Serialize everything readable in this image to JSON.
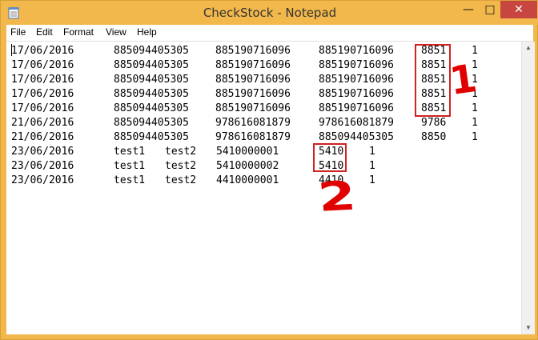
{
  "window": {
    "title": "CheckStock - Notepad",
    "controls": {
      "minimize": "—",
      "maximize": "□",
      "close": "✕"
    }
  },
  "menu": [
    "File",
    "Edit",
    "Format",
    "View",
    "Help"
  ],
  "colors": {
    "title_bar": "#f2b84b",
    "close_button": "#c7463f",
    "annotation": "#e00000"
  },
  "lines": [
    [
      "17/06/2016",
      "885094405305",
      "885190716096",
      "885190716096",
      "8851",
      "1"
    ],
    [
      "17/06/2016",
      "885094405305",
      "885190716096",
      "885190716096",
      "8851",
      "1"
    ],
    [
      "17/06/2016",
      "885094405305",
      "885190716096",
      "885190716096",
      "8851",
      "1"
    ],
    [
      "17/06/2016",
      "885094405305",
      "885190716096",
      "885190716096",
      "8851",
      "1"
    ],
    [
      "17/06/2016",
      "885094405305",
      "885190716096",
      "885190716096",
      "8851",
      "1"
    ],
    [
      "21/06/2016",
      "885094405305",
      "978616081879",
      "978616081879",
      "9786",
      "1"
    ],
    [
      "21/06/2016",
      "885094405305",
      "978616081879",
      "885094405305",
      "8850",
      "1"
    ],
    [
      "23/06/2016",
      "test1",
      "test2",
      "5410000001",
      "5410",
      "1"
    ],
    [
      "23/06/2016",
      "test1",
      "test2",
      "5410000002",
      "5410",
      "1"
    ],
    [
      "23/06/2016",
      "test1",
      "test2",
      "4410000001",
      "4410",
      "1"
    ]
  ],
  "annotations": {
    "marker_1": "1",
    "marker_2": "2"
  }
}
